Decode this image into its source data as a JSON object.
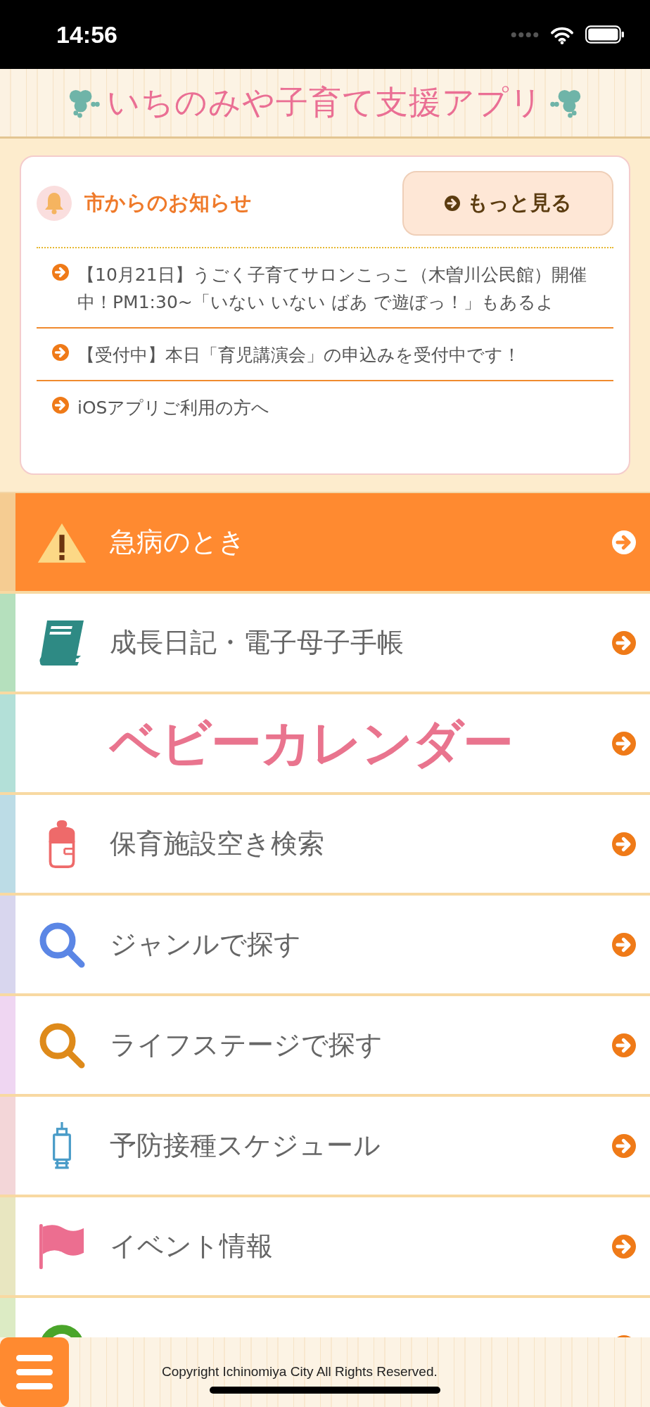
{
  "status_bar": {
    "time": "14:56"
  },
  "header": {
    "title": "いちのみや子育て支援アプリ"
  },
  "notices": {
    "heading": "市からのお知らせ",
    "more_button": "もっと見る",
    "items": [
      {
        "text": "【10月21日】うごく子育てサロンこっこ（木曽川公民館）開催中！PM1:30~「いない いない ばあ で遊ぼっ！」もあるよ"
      },
      {
        "text": "【受付中】本日「育児講演会」の申込みを受付中です！"
      },
      {
        "text": "iOSアプリご利用の方へ"
      }
    ]
  },
  "menu": [
    {
      "label": "急病のとき",
      "kind": "alert",
      "color": "#f5cc92"
    },
    {
      "label": "成長日記・電子母子手帳",
      "kind": "text",
      "color": "#b5e0bd"
    },
    {
      "label": "ベビーカレンダー",
      "kind": "logo",
      "color": "#b3e0d8"
    },
    {
      "label": "保育施設空き検索",
      "kind": "text",
      "color": "#bcdce6"
    },
    {
      "label": "ジャンルで探す",
      "kind": "text",
      "color": "#d8d6ee"
    },
    {
      "label": "ライフステージで探す",
      "kind": "text",
      "color": "#efd6f2"
    },
    {
      "label": "予防接種スケジュール",
      "kind": "text",
      "color": "#f3d6d8"
    },
    {
      "label": "イベント情報",
      "kind": "text",
      "color": "#e8e6c0"
    },
    {
      "kind": "text",
      "color": "#dcebc4"
    }
  ],
  "footer": {
    "copyright": "Copyright Ichinomiya City All Rights Reserved."
  }
}
